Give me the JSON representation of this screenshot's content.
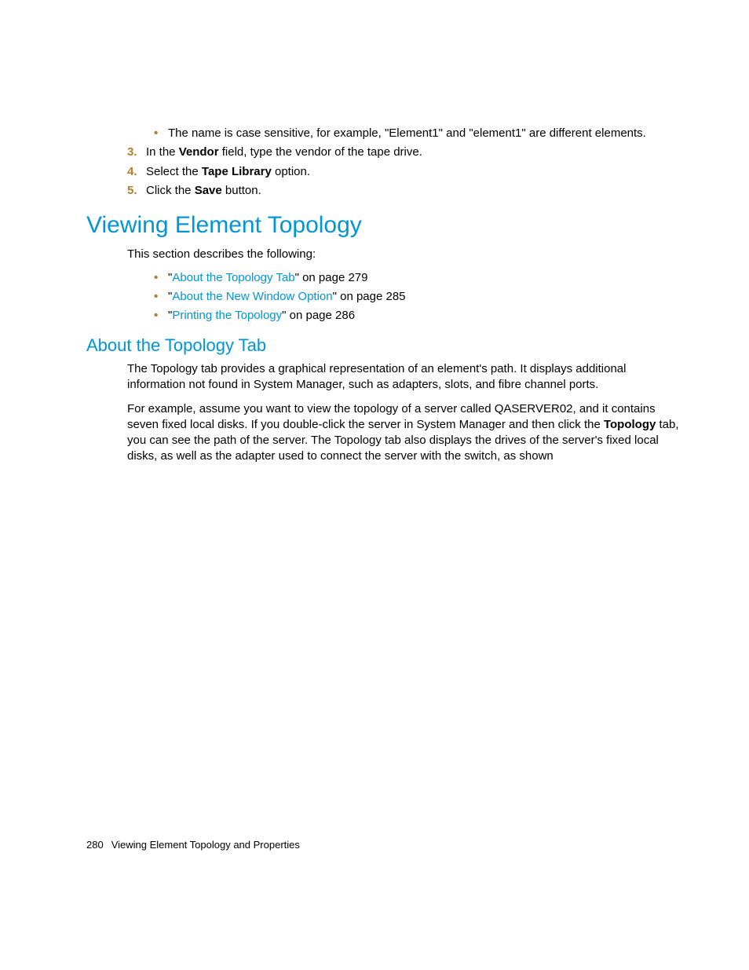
{
  "list0": {
    "bullet": "•",
    "text": "The name is case sensitive, for example, \"Element1\" and \"element1\" are different elements."
  },
  "ol": {
    "three": {
      "num": "3.",
      "pre": "In the ",
      "bold": "Vendor",
      "post": " field, type the vendor of the tape drive."
    },
    "four": {
      "num": "4.",
      "pre": "Select the ",
      "bold": "Tape Library",
      "post": " option."
    },
    "five": {
      "num": "5.",
      "pre": "Click the ",
      "bold": "Save",
      "post": " button."
    }
  },
  "h1": "Viewing Element Topology",
  "intro": "This section describes the following:",
  "links": {
    "bullet": "•",
    "q1a": "\"",
    "l1": "About the Topology Tab",
    "q1b": "\" on page 279",
    "q2a": "\"",
    "l2": "About the New Window Option",
    "q2b": "\" on page 285",
    "q3a": "\"",
    "l3": "Printing the Topology",
    "q3b": "\" on page 286"
  },
  "h2": "About the Topology Tab",
  "p1": "The Topology tab provides a graphical representation of an element's path. It displays additional information not found in System Manager, such as adapters, slots, and fibre channel ports.",
  "p2a": "For example, assume you want to view the topology of a server called QASERVER02, and it contains seven fixed local disks. If you double-click the server in System Manager and then click the ",
  "p2bold": "Topology",
  "p2b": " tab, you can see the path of the server. The Topology tab also displays the drives of the server's fixed local disks, as well as the adapter used to connect the server with the switch, as shown",
  "footer": {
    "page": "280",
    "title": "Viewing Element Topology and Properties"
  }
}
